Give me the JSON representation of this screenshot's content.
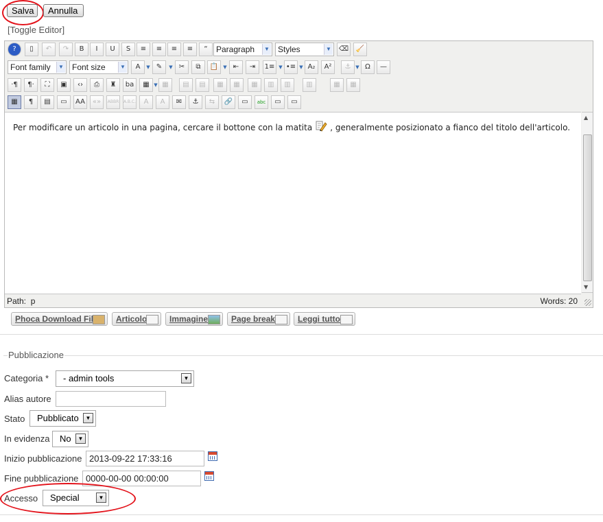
{
  "top_buttons": {
    "save": "Salva",
    "cancel": "Annulla"
  },
  "toggle_editor": "[Toggle Editor]",
  "toolbar": {
    "format_select": "Paragraph",
    "styles_select": "Styles",
    "font_family": "Font family",
    "font_size": "Font size",
    "row1_icons": [
      "help-icon",
      "new-document-icon",
      "undo-icon",
      "redo-icon",
      "bold-icon",
      "italic-icon",
      "underline-icon",
      "strikethrough-icon",
      "justify-full-icon",
      "align-center-icon",
      "align-left-icon",
      "align-right-icon",
      "blockquote-icon"
    ],
    "row1_glyphs": [
      "?",
      "▯",
      "↶",
      "↷",
      "B",
      "I",
      "U",
      "S",
      "≡",
      "≡",
      "≡",
      "≡",
      "“"
    ],
    "row2_icons": [
      "text-color-icon",
      "highlight-icon",
      "cut-icon",
      "copy-icon",
      "paste-icon",
      "outdent-icon",
      "indent-icon",
      "ordered-list-icon",
      "bullet-list-icon",
      "subscript-icon",
      "superscript-icon",
      "anchor-icon",
      "special-char-icon",
      "horizontal-rule-icon"
    ],
    "row2_glyphs": [
      "A",
      "✎",
      "✂",
      "⧉",
      "📋",
      "⇤",
      "⇥",
      "1≡",
      "•≡",
      "A₂",
      "A²",
      "⚓",
      "Ω",
      "—"
    ],
    "row3_glyphs": [
      "·¶",
      "¶·",
      "⛶",
      "▣",
      "‹›",
      "⎙",
      "♜",
      "ba",
      "▦",
      "▦",
      "▤",
      "▤",
      "▦",
      "▦",
      "▦",
      "▥",
      "▥",
      "▥",
      "▦",
      "▦"
    ],
    "row4_glyphs": [
      "▦",
      "¶",
      "▤",
      "▭",
      "AA",
      "«»",
      "ABBR",
      "A.B.C.",
      "A",
      "A",
      "✉",
      "⚓",
      "⇆",
      "🔗",
      "▭",
      "abc",
      "▭",
      "▭"
    ]
  },
  "editor": {
    "text_before": "Per modificare un articolo in una pagina, cercare il bottone con la matita",
    "text_after": ", generalmente posizionato a fianco del titolo dell'articolo.",
    "path_label": "Path:",
    "path_value": "p",
    "words_label": "Words: 20"
  },
  "extra_buttons": [
    "Phoca Download File",
    "Articolo",
    "Immagine",
    "Page break",
    "Leggi tutto"
  ],
  "publication": {
    "legend": "Pubblicazione",
    "category_label": "Categoria *",
    "category_value": "- admin tools",
    "alias_label": "Alias autore",
    "alias_value": "",
    "state_label": "Stato",
    "state_value": "Pubblicato",
    "featured_label": "In evidenza",
    "featured_value": "No",
    "start_label": "Inizio pubblicazione",
    "start_value": "2013-09-22 17:33:16",
    "end_label": "Fine pubblicazione",
    "end_value": "0000-00-00 00:00:00",
    "access_label": "Accesso",
    "access_value": "Special"
  },
  "colors": {
    "annotation_red": "#e3131b",
    "toolbar_bg": "#f0f0ee",
    "accent_blue": "#3a6fb5"
  }
}
